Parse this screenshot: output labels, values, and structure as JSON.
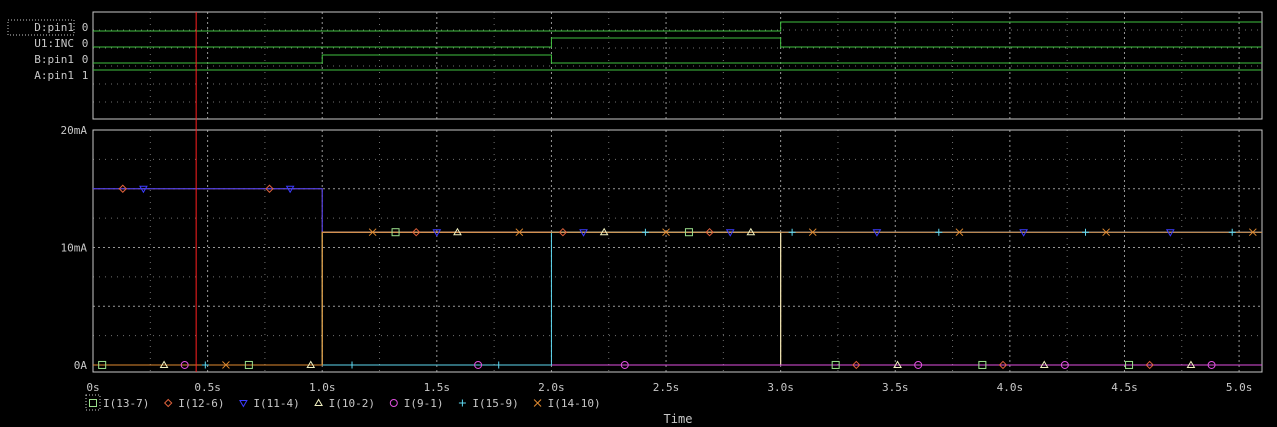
{
  "colors": {
    "background": "#000000",
    "frame": "#c8c8c8",
    "grid": "#bdbdbd",
    "text": "#c8c8c8",
    "digital": "#3fbf3f",
    "cursor": "#ff2020"
  },
  "digital_panel": {
    "signals": [
      {
        "name": "D:pin1",
        "value": "0",
        "selected": true
      },
      {
        "name": "U1:INC",
        "value": "0",
        "selected": false
      },
      {
        "name": "B:pin1",
        "value": "0",
        "selected": false
      },
      {
        "name": "A:pin1",
        "value": "1",
        "selected": false
      }
    ]
  },
  "chart_data": {
    "type": "line",
    "title": "",
    "xlabel": "Time",
    "ylabel": "",
    "xlim": [
      0,
      5.1
    ],
    "ylim": [
      -0.6,
      20
    ],
    "x_ticks": [
      {
        "v": 0,
        "label": "0s"
      },
      {
        "v": 0.5,
        "label": "0.5s"
      },
      {
        "v": 1,
        "label": "1.0s"
      },
      {
        "v": 1.5,
        "label": "1.5s"
      },
      {
        "v": 2,
        "label": "2.0s"
      },
      {
        "v": 2.5,
        "label": "2.5s"
      },
      {
        "v": 3,
        "label": "3.0s"
      },
      {
        "v": 3.5,
        "label": "3.5s"
      },
      {
        "v": 4,
        "label": "4.0s"
      },
      {
        "v": 4.5,
        "label": "4.5s"
      },
      {
        "v": 5,
        "label": "5.0s"
      }
    ],
    "y_ticks": [
      {
        "v": 0,
        "label": "0A"
      },
      {
        "v": 10,
        "label": "10mA"
      },
      {
        "v": 20,
        "label": "20mA"
      }
    ],
    "cursor_x": 0.45,
    "grid": true,
    "legend_position": "bottom-left",
    "series": [
      {
        "name": "I(13-7)",
        "color": "#9be08c",
        "marker": "square",
        "x": [
          0,
          1,
          1,
          3,
          3,
          5.1
        ],
        "y": [
          0,
          0,
          11.3,
          11.3,
          0,
          0
        ]
      },
      {
        "name": "I(12-6)",
        "color": "#e0623c",
        "marker": "diamond",
        "x": [
          0,
          1,
          1,
          3,
          3,
          5.1
        ],
        "y": [
          15,
          15,
          11.3,
          11.3,
          0,
          0
        ]
      },
      {
        "name": "I(11-4)",
        "color": "#3c3cff",
        "marker": "triangle-down",
        "x": [
          0,
          1,
          1,
          3,
          3,
          5.1
        ],
        "y": [
          15,
          15,
          11.3,
          11.3,
          11.3,
          11.3
        ]
      },
      {
        "name": "I(10-2)",
        "color": "#f0f0c0",
        "marker": "triangle-up",
        "x": [
          0,
          1,
          1,
          3,
          3,
          5.1
        ],
        "y": [
          0,
          0,
          11.3,
          11.3,
          0,
          0
        ]
      },
      {
        "name": "I(9-1)",
        "color": "#e050e0",
        "marker": "circle",
        "x": [
          0,
          5.1
        ],
        "y": [
          0,
          0
        ]
      },
      {
        "name": "I(15-9)",
        "color": "#5ed8f0",
        "marker": "plus",
        "x": [
          0,
          2,
          2,
          5.1
        ],
        "y": [
          0,
          0,
          11.3,
          11.3
        ]
      },
      {
        "name": "I(14-10)",
        "color": "#e08a30",
        "marker": "x",
        "x": [
          0,
          1,
          1,
          3,
          3,
          5.1
        ],
        "y": [
          0,
          0,
          11.3,
          11.3,
          11.3,
          11.3
        ]
      }
    ]
  }
}
